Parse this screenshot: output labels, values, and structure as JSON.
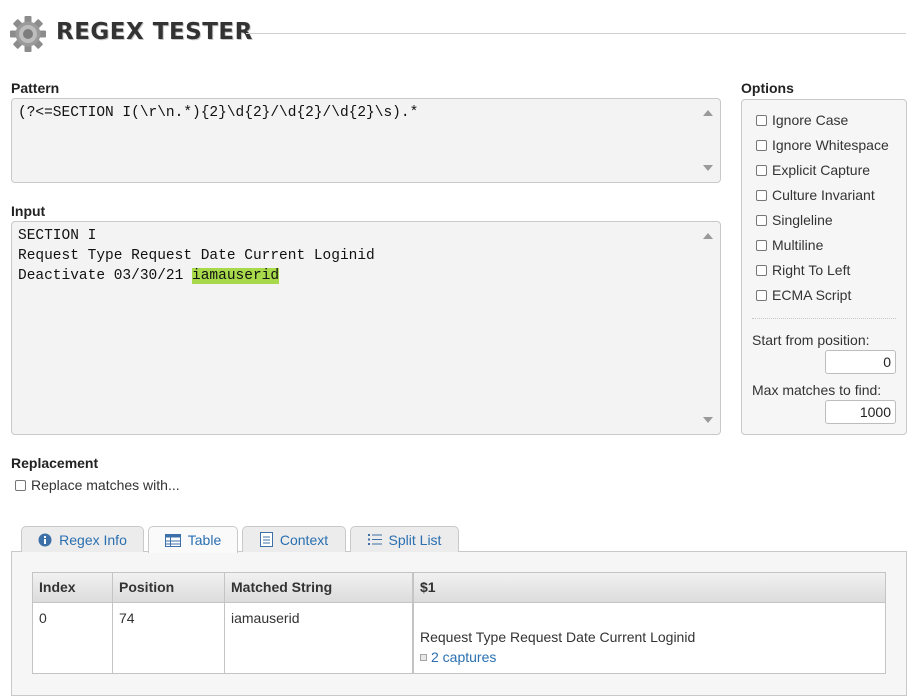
{
  "header": {
    "title": "REGEX TESTER",
    "logo_icon": "gear-icon"
  },
  "pattern": {
    "label": "Pattern",
    "value": "(?<=SECTION I(\\r\\n.*){2}\\d{2}/\\d{2}/\\d{2}\\s).*"
  },
  "input": {
    "label": "Input",
    "lines": [
      {
        "text": "SECTION I",
        "match": ""
      },
      {
        "text": "Request Type Request Date Current Loginid",
        "match": ""
      },
      {
        "text": "Deactivate 03/30/21 ",
        "match": "iamauserid"
      }
    ],
    "highlight_color": "#a8d94a"
  },
  "options": {
    "label": "Options",
    "checkboxes": [
      {
        "label": "Ignore Case",
        "checked": false
      },
      {
        "label": "Ignore Whitespace",
        "checked": false
      },
      {
        "label": "Explicit Capture",
        "checked": false
      },
      {
        "label": "Culture Invariant",
        "checked": false
      },
      {
        "label": "Singleline",
        "checked": false
      },
      {
        "label": "Multiline",
        "checked": false
      },
      {
        "label": "Right To Left",
        "checked": false
      },
      {
        "label": "ECMA Script",
        "checked": false
      }
    ],
    "start_label": "Start from position:",
    "start_value": "0",
    "max_label": "Max matches to find:",
    "max_value": "1000"
  },
  "replacement": {
    "label": "Replacement",
    "checkbox_label": "Replace matches with...",
    "checked": false
  },
  "tabs": [
    {
      "label": "Regex Info",
      "icon": "info-icon",
      "active": false
    },
    {
      "label": "Table",
      "icon": "table-icon",
      "active": true
    },
    {
      "label": "Context",
      "icon": "document-icon",
      "active": false
    },
    {
      "label": "Split List",
      "icon": "list-icon",
      "active": false
    }
  ],
  "results": {
    "columns": [
      "Index",
      "Position",
      "Matched String",
      "$1"
    ],
    "rows": [
      {
        "index": "0",
        "position": "74",
        "matched": "iamauserid",
        "group1": "Request Type Request Date Current Loginid",
        "captures_link": "2 captures"
      }
    ]
  },
  "colors": {
    "link": "#2a6fb0",
    "match_highlight": "#a8d94a"
  }
}
